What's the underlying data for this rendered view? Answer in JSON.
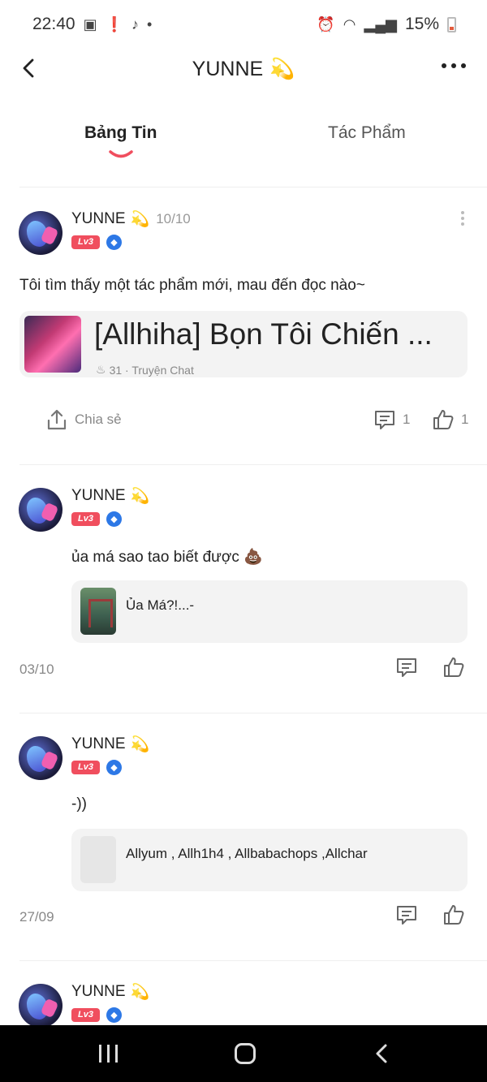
{
  "status_bar": {
    "time": "22:40",
    "dot": "•",
    "battery": "15%"
  },
  "header": {
    "title": "YUNNE",
    "title_emoji": "💫"
  },
  "tabs": [
    {
      "label": "Bảng Tin"
    },
    {
      "label": "Tác Phẩm"
    }
  ],
  "posts": [
    {
      "username": "YUNNE",
      "emoji": "💫",
      "date": "10/10",
      "level": "Lv3",
      "text": "Tôi tìm thấy một tác phẩm mới, mau đến đọc nào~",
      "card_title": "[Allhiha] Bọn Tôi Chiến ...",
      "card_meta": "31 · Truyện Chat",
      "share_label": "Chia sẻ",
      "comments": "1",
      "likes": "1"
    },
    {
      "username": "YUNNE",
      "emoji": "💫",
      "level": "Lv3",
      "text": "ủa má sao tao biết được 💩",
      "card_title": "Ủa Má?!...-",
      "date": "03/10"
    },
    {
      "username": "YUNNE",
      "emoji": "💫",
      "level": "Lv3",
      "text": "-))",
      "card_title": "Allyum , Allh1h4 , Allbabachops ,Allchar",
      "date": "27/09"
    },
    {
      "username": "YUNNE",
      "emoji": "💫",
      "level": "Lv3"
    }
  ],
  "icons": {
    "back": "chevron-left-icon",
    "more": "more-horizontal-icon",
    "kebab": "more-vertical-icon",
    "share": "share-icon",
    "comment": "comment-icon",
    "like": "thumbs-up-icon",
    "verified": "shield-icon"
  },
  "colors": {
    "accent": "#f04e5e",
    "verified": "#2d78e6",
    "card_bg": "#f3f3f3"
  }
}
